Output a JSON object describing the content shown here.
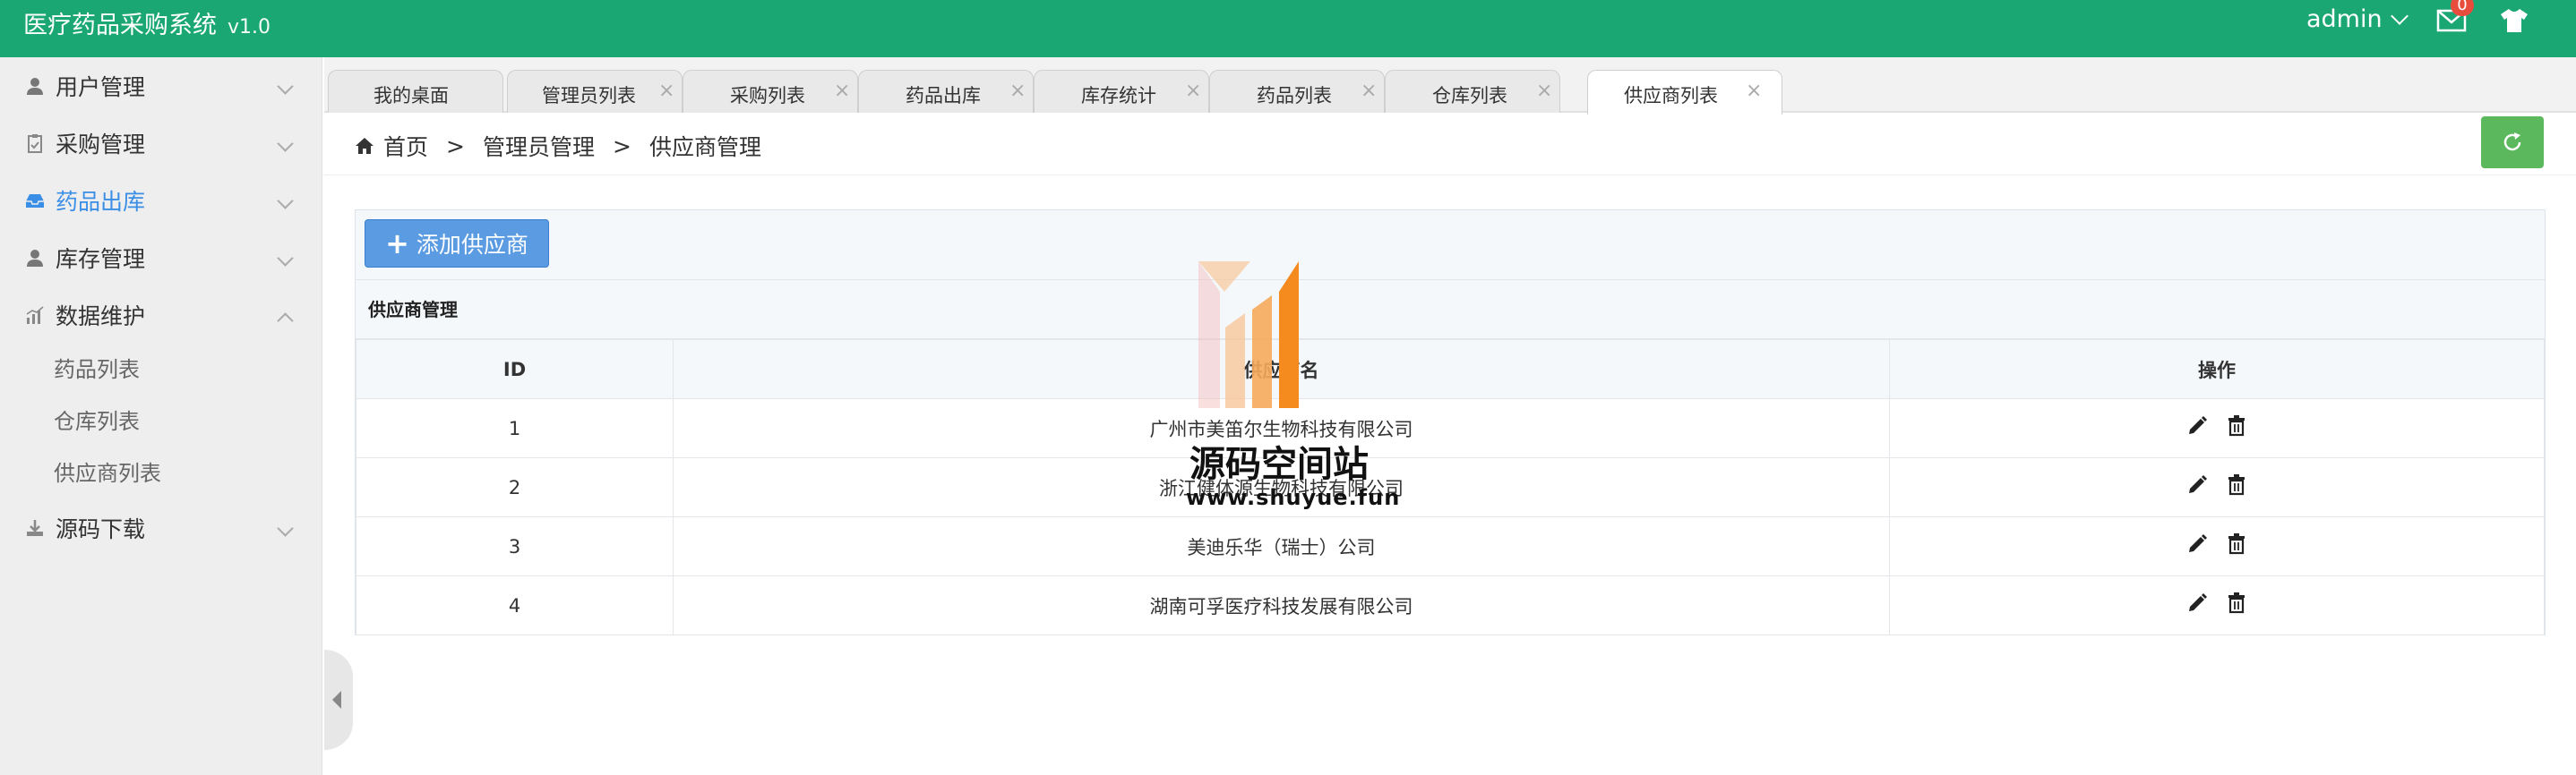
{
  "app": {
    "title": "医疗药品采购系统",
    "version": "v1.0"
  },
  "header": {
    "username": "admin",
    "mail_count": "0"
  },
  "sidebar": {
    "items": [
      {
        "label": "用户管理",
        "icon": "user-icon"
      },
      {
        "label": "采购管理",
        "icon": "clipboard-icon"
      },
      {
        "label": "药品出库",
        "icon": "inbox-icon"
      },
      {
        "label": "库存管理",
        "icon": "user-icon"
      },
      {
        "label": "数据维护",
        "icon": "bar-chart-icon"
      },
      {
        "label": "源码下载",
        "icon": "download-icon"
      }
    ],
    "subitems": [
      "药品列表",
      "仓库列表",
      "供应商列表"
    ]
  },
  "tabs": [
    "我的桌面",
    "管理员列表",
    "采购列表",
    "药品出库",
    "库存统计",
    "药品列表",
    "仓库列表",
    "供应商列表"
  ],
  "breadcrumb": {
    "home": "首页",
    "sep": ">",
    "level1": "管理员管理",
    "level2": "供应商管理"
  },
  "toolbar": {
    "add_label": "添加供应商"
  },
  "panel": {
    "title": "供应商管理"
  },
  "table": {
    "headers": [
      "ID",
      "供应商名",
      "操作"
    ],
    "rows": [
      {
        "id": "1",
        "name": "广州市美笛尔生物科技有限公司"
      },
      {
        "id": "2",
        "name": "浙江健体源生物科技有限公司"
      },
      {
        "id": "3",
        "name": "美迪乐华（瑞士）公司"
      },
      {
        "id": "4",
        "name": "湖南可孚医疗科技发展有限公司"
      }
    ]
  },
  "watermark": {
    "title": "源码空间站",
    "url": "www.shuyue.fun"
  },
  "colors": {
    "topbar": "#1aa774",
    "accent": "#3a8ee6",
    "add_button": "#5a9be2",
    "refresh_button": "#5cb85c",
    "badge": "#e84c3d"
  }
}
